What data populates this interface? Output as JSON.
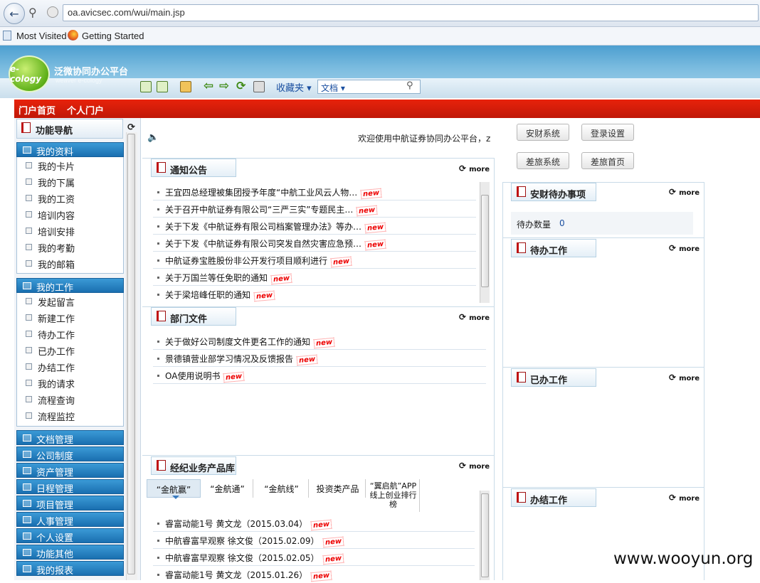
{
  "browser": {
    "url": "oa.avicsec.com/wui/main.jsp",
    "bookmarks": [
      "Most Visited",
      "Getting Started"
    ]
  },
  "app": {
    "logo_text": "e-cology",
    "title": "泛微协同办公平台",
    "subtitle": "weaver e-cology",
    "favorites_label": "收藏夹",
    "search_type": "文档",
    "search_value": ""
  },
  "redbar": {
    "tabs": [
      "门户首页",
      "个人门户"
    ]
  },
  "sidebar": {
    "title": "功能导航",
    "groups": [
      {
        "label": "我的资料",
        "items": [
          "我的卡片",
          "我的下属",
          "我的工资",
          "培训内容",
          "培训安排",
          "我的考勤",
          "我的邮箱"
        ]
      },
      {
        "label": "我的工作",
        "items": [
          "发起留言",
          "新建工作",
          "待办工作",
          "已办工作",
          "办结工作",
          "我的请求",
          "流程查询",
          "流程监控"
        ]
      }
    ],
    "categories": [
      "文档管理",
      "公司制度",
      "资产管理",
      "日程管理",
      "项目管理",
      "人事管理",
      "个人设置",
      "功能其他",
      "我的报表"
    ]
  },
  "welcome": "欢迎使用中航证券协同办公平台，z",
  "more_label": "more",
  "new_badge": "new",
  "notice": {
    "title": "通知公告",
    "items": [
      "王宜四总经理被集团授予年度“中航工业风云人物…",
      "关于召开中航证券有限公司“三严三实”专题民主…",
      "关于下发《中航证券有限公司档案管理办法》等办…",
      "关于下发《中航证券有限公司突发自然灾害应急预…",
      "中航证券宝胜股份非公开发行项目顺利进行",
      "关于万国兰等任免职的通知",
      "关于梁培峰任职的通知"
    ]
  },
  "dept": {
    "title": "部门文件",
    "items": [
      "关于做好公司制度文件更名工作的通知",
      "景德镇营业部学习情况及反馈报告",
      "OA使用说明书"
    ]
  },
  "products": {
    "title": "经纪业务产品库",
    "tabs": [
      "“金航赢”",
      "“金航通”",
      "“金航线”",
      "投资类产品",
      "“翼启航”APP线上创业排行榜"
    ],
    "items": [
      "睿富动能1号 黄文龙（2015.03.04）",
      "中航睿富早观察 徐文俊（2015.02.09）",
      "中航睿富早观察 徐文俊（2015.02.05）",
      "睿富动能1号 黄文龙（2015.01.26）"
    ]
  },
  "quick_buttons": [
    "安财系统",
    "登录设置",
    "差旅系统",
    "差旅首页"
  ],
  "todo": {
    "title": "安财待办事项",
    "count_label": "待办数量",
    "count_value": "0"
  },
  "right_panels": [
    "待办工作",
    "已办工作",
    "办结工作"
  ],
  "watermark": "www.wooyun.org"
}
